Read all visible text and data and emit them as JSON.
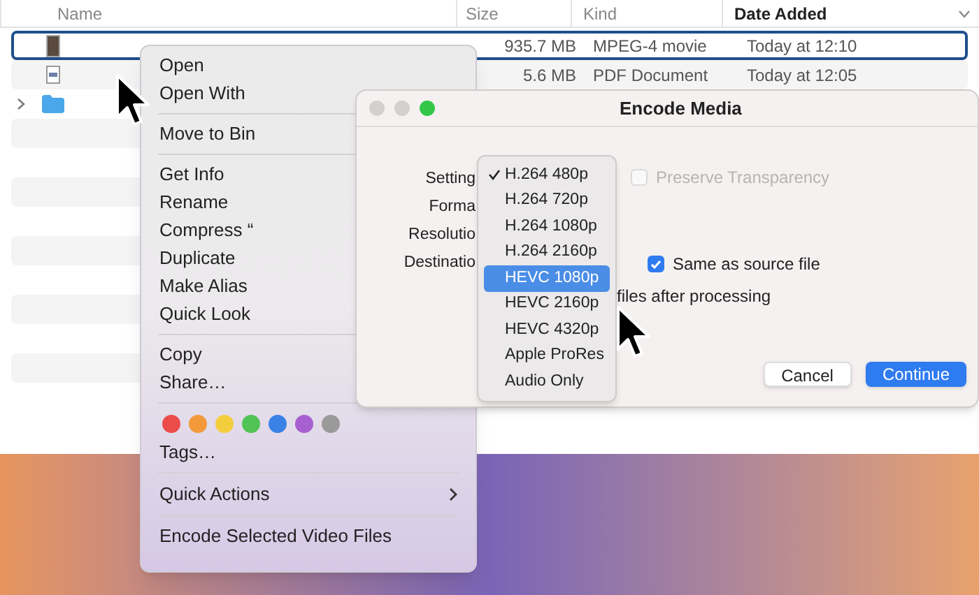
{
  "finder": {
    "columns": [
      {
        "label": "Name",
        "sorted": false
      },
      {
        "label": "Size",
        "sorted": false
      },
      {
        "label": "Kind",
        "sorted": false
      },
      {
        "label": "Date Added",
        "sorted": true
      }
    ],
    "rows": [
      {
        "kind": "video",
        "size": "935.7 MB",
        "type": "MPEG-4 movie",
        "date": "Today at 12:10",
        "selected": true
      },
      {
        "kind": "pdf",
        "size": "5.6 MB",
        "type": "PDF Document",
        "date": "Today at 12:05",
        "selected": false
      },
      {
        "kind": "folder",
        "selected": false
      }
    ]
  },
  "context_menu": {
    "sections": [
      [
        "Open",
        "Open With"
      ],
      [
        "Move to Bin"
      ],
      [
        "Get Info",
        "Rename",
        "Compress “",
        "Duplicate",
        "Make Alias",
        "Quick Look"
      ],
      [
        "Copy",
        "Share…"
      ]
    ],
    "tags": [
      {
        "color": "#ec4b4b"
      },
      {
        "color": "#f29a3a"
      },
      {
        "color": "#f4cd3c"
      },
      {
        "color": "#52c356"
      },
      {
        "color": "#3b82e6"
      },
      {
        "color": "#a660d0"
      },
      {
        "color": "#9a9a9a"
      }
    ],
    "tags_item": "Tags…",
    "quick_actions": {
      "label": "Quick Actions",
      "submenu": true
    },
    "service_item": "Encode Selected Video Files"
  },
  "dialog": {
    "title": "Encode Media",
    "labels": [
      "Setting",
      "Forma",
      "Resolutio",
      "Destinatio"
    ],
    "preserve_transparency": {
      "label": "Preserve Transparency",
      "checked": false,
      "disabled": true
    },
    "same_as_source": {
      "label": "Same as source file",
      "checked": true
    },
    "after_processing": "files after processing",
    "options": [
      {
        "label": "H.264 480p",
        "checked": true,
        "highlighted": false
      },
      {
        "label": "H.264 720p",
        "checked": false,
        "highlighted": false
      },
      {
        "label": "H.264 1080p",
        "checked": false,
        "highlighted": false
      },
      {
        "label": "H.264 2160p",
        "checked": false,
        "highlighted": false
      },
      {
        "label": "HEVC 1080p",
        "checked": false,
        "highlighted": true
      },
      {
        "label": "HEVC 2160p",
        "checked": false,
        "highlighted": false
      },
      {
        "label": "HEVC 4320p",
        "checked": false,
        "highlighted": false
      },
      {
        "label": "Apple ProRes",
        "checked": false,
        "highlighted": false
      },
      {
        "label": "Audio Only",
        "checked": false,
        "highlighted": false
      }
    ],
    "buttons": [
      {
        "label": "Cancel",
        "default": false
      },
      {
        "label": "Continue",
        "default": true
      }
    ]
  }
}
